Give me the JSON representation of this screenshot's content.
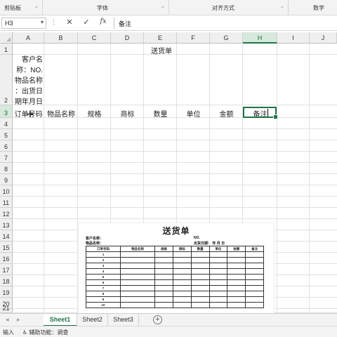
{
  "ribbon": {
    "groups": [
      "剪贴板",
      "字体",
      "对齐方式",
      "数字"
    ]
  },
  "formula_bar": {
    "name_box": "H3",
    "cancel_glyph": "✕",
    "enter_glyph": "✓",
    "fx_label": "fx",
    "content": "备注"
  },
  "columns": [
    "A",
    "B",
    "C",
    "D",
    "E",
    "F",
    "G",
    "H",
    "I",
    "J"
  ],
  "rows": [
    "1",
    "2",
    "3",
    "4",
    "5",
    "6",
    "7",
    "8",
    "9",
    "10",
    "11",
    "12",
    "13",
    "14",
    "15",
    "16",
    "17",
    "18",
    "19",
    "20",
    "21"
  ],
  "selection": {
    "column": "H",
    "row": "3"
  },
  "cells": {
    "E1": "送货单",
    "A2_lines": [
      "客户名",
      "称：NO.",
      "物品名称",
      "：出货日",
      "期年月日"
    ],
    "row3": [
      "订单号码",
      "物品名称",
      "规格",
      "商标",
      "数量",
      "单位",
      "金额",
      "备注"
    ]
  },
  "picture": {
    "title": "送货单",
    "customer": "客户名称：",
    "item": "物品名称：",
    "no": "NO.",
    "date": "出货日期：   年   月   日",
    "headers": [
      "订单号码",
      "物品名称",
      "规格",
      "商标",
      "数量",
      "单位",
      "金额",
      "备注"
    ],
    "row_numbers": [
      "1",
      "2",
      "3",
      "4",
      "5",
      "6",
      "7",
      "8",
      "9",
      "10"
    ]
  },
  "sheet_tabs": [
    "Sheet1",
    "Sheet2",
    "Sheet3"
  ],
  "active_tab": "Sheet1",
  "add_sheet_glyph": "+",
  "status": {
    "mode": "输入",
    "accessibility": "辅助功能：调查"
  },
  "colors": {
    "accent": "#217346",
    "selected_header": "#d6e9dc"
  }
}
